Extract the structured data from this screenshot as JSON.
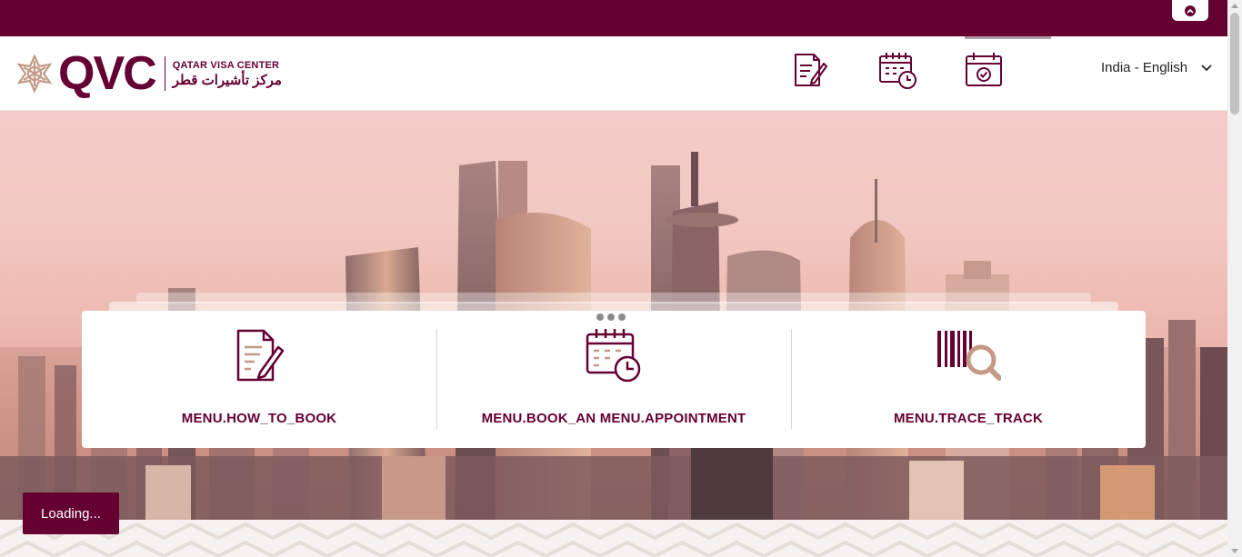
{
  "brand": {
    "logo_text": "QVC",
    "name_en": "QATAR VISA CENTER",
    "name_ar": "مركز تأشيرات قطر"
  },
  "header": {
    "nav_icons": [
      "application-form-icon",
      "calendar-clock-icon",
      "calendar-check-icon"
    ],
    "active_nav": "calendar-check-icon",
    "language": "India - English"
  },
  "services": [
    {
      "label": "MENU.HOW_TO_BOOK",
      "icon": "form-pen-icon"
    },
    {
      "label": "MENU.BOOK_AN MENU.APPOINTMENT",
      "icon": "calendar-clock-icon"
    },
    {
      "label": "MENU.TRACE_TRACK",
      "icon": "barcode-search-icon"
    }
  ],
  "status": {
    "loading_text": "Loading..."
  },
  "colors": {
    "brand": "#640032",
    "accent": "#c49a86"
  }
}
